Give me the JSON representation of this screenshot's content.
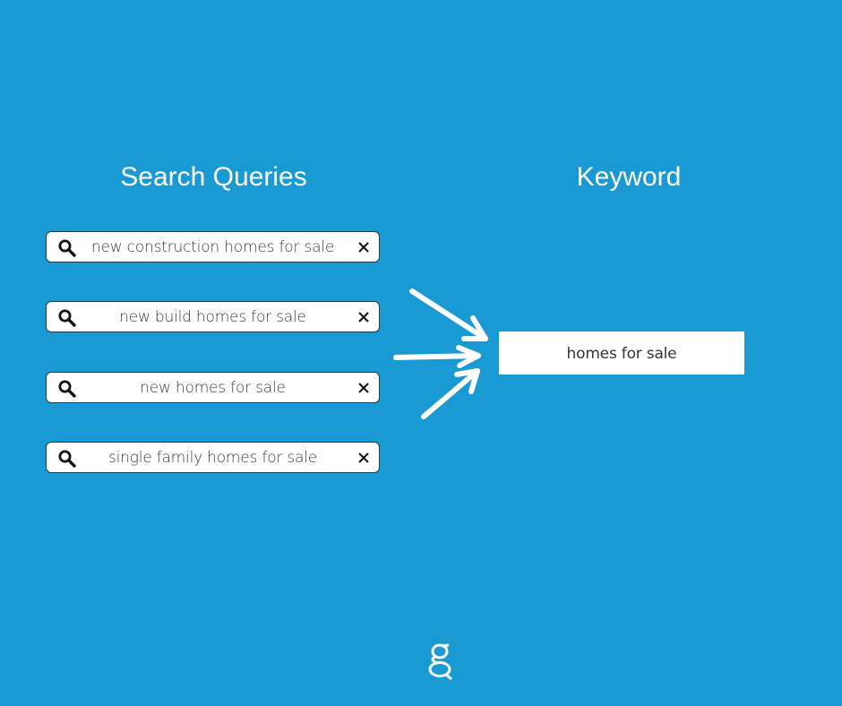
{
  "headings": {
    "left": "Search Queries",
    "right": "Keyword"
  },
  "queries": [
    {
      "text": "new construction homes for sale",
      "icon": "search-icon",
      "clear_icon": "close-icon"
    },
    {
      "text": "new build homes for sale",
      "icon": "search-icon",
      "clear_icon": "close-icon"
    },
    {
      "text": "new homes for sale",
      "icon": "search-icon",
      "clear_icon": "close-icon"
    },
    {
      "text": "single family homes for sale",
      "icon": "search-icon",
      "clear_icon": "close-icon"
    }
  ],
  "keyword": {
    "text": "homes for sale"
  },
  "logo": {
    "icon": "g-logo-icon"
  },
  "colors": {
    "background": "#1a9ad3",
    "box": "#ffffff",
    "text": "#3a3a3a",
    "arrows": "#ffffff"
  }
}
